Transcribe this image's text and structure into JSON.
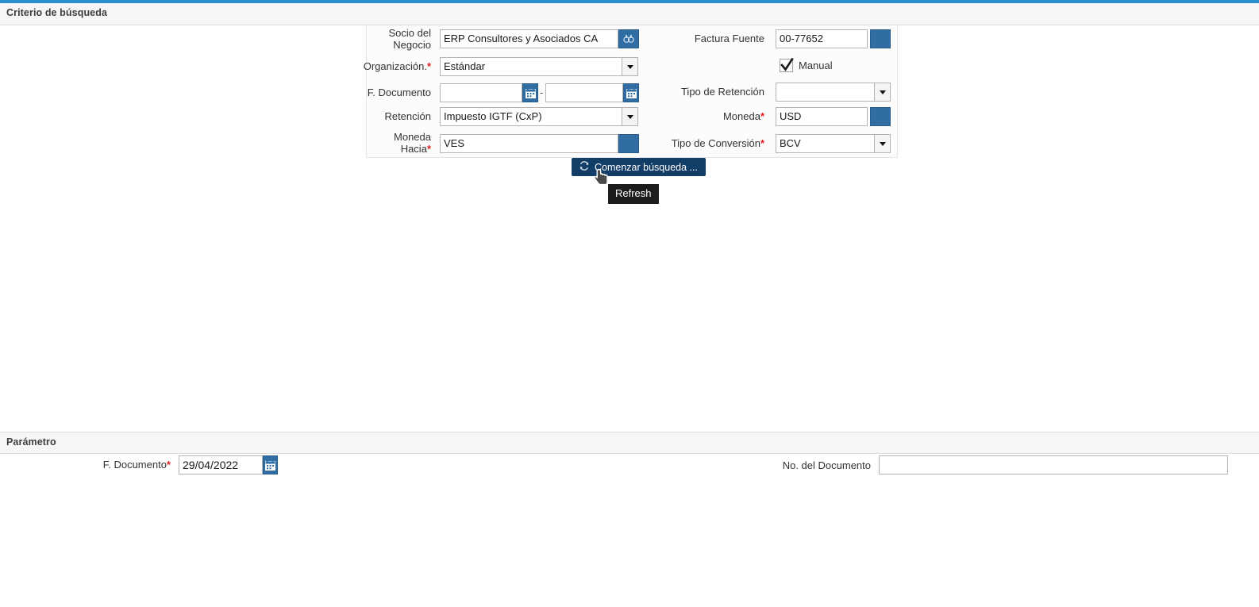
{
  "accent_color": "#2a91ce",
  "sections": {
    "criteria": {
      "title": "Criterio de búsqueda"
    },
    "parameter": {
      "title": "Parámetro"
    }
  },
  "criteria": {
    "left_column": [
      {
        "label": "Socio del Negocio",
        "required": false,
        "type": "lookup-text",
        "value": "ERP Consultores y Asociados CA",
        "button_icon": "binoculars-icon"
      },
      {
        "label": "Organización.",
        "required": true,
        "type": "dropdown",
        "value": "Estándar"
      },
      {
        "label": "F. Documento",
        "required": false,
        "type": "date-range",
        "value_from": "",
        "value_to": "",
        "separator": "-",
        "button_icon": "calendar-icon"
      },
      {
        "label": "Retención",
        "required": false,
        "type": "dropdown",
        "value": "Impuesto IGTF (CxP)"
      },
      {
        "label": "Moneda Hacia",
        "required": true,
        "type": "lookup-text",
        "value": "VES",
        "button_icon": "record-lookup-icon"
      }
    ],
    "right_column": [
      {
        "label": "Factura Fuente",
        "required": false,
        "type": "lookup-text",
        "value": "00-77652",
        "button_icon": "record-lookup-icon"
      },
      {
        "label": "",
        "required": false,
        "type": "checkbox",
        "checkbox_label": "Manual",
        "checked": true
      },
      {
        "label": "Tipo de Retención",
        "required": false,
        "type": "dropdown",
        "value": ""
      },
      {
        "label": "Moneda",
        "required": true,
        "type": "lookup-text",
        "value": "USD",
        "button_icon": "record-lookup-icon"
      },
      {
        "label": "Tipo de Conversión",
        "required": true,
        "type": "dropdown",
        "value": "BCV"
      }
    ],
    "search_button": {
      "label": "Comenzar búsqueda ...",
      "icon": "refresh-icon",
      "color": "#123d66"
    },
    "tooltip": {
      "text": "Refresh"
    }
  },
  "parameter": {
    "fields": [
      {
        "label": "F. Documento",
        "required": true,
        "type": "date",
        "value": "29/04/2022",
        "button_icon": "calendar-icon"
      },
      {
        "label": "No. del Documento",
        "required": false,
        "type": "text",
        "value": "",
        "placeholder": ""
      }
    ]
  }
}
